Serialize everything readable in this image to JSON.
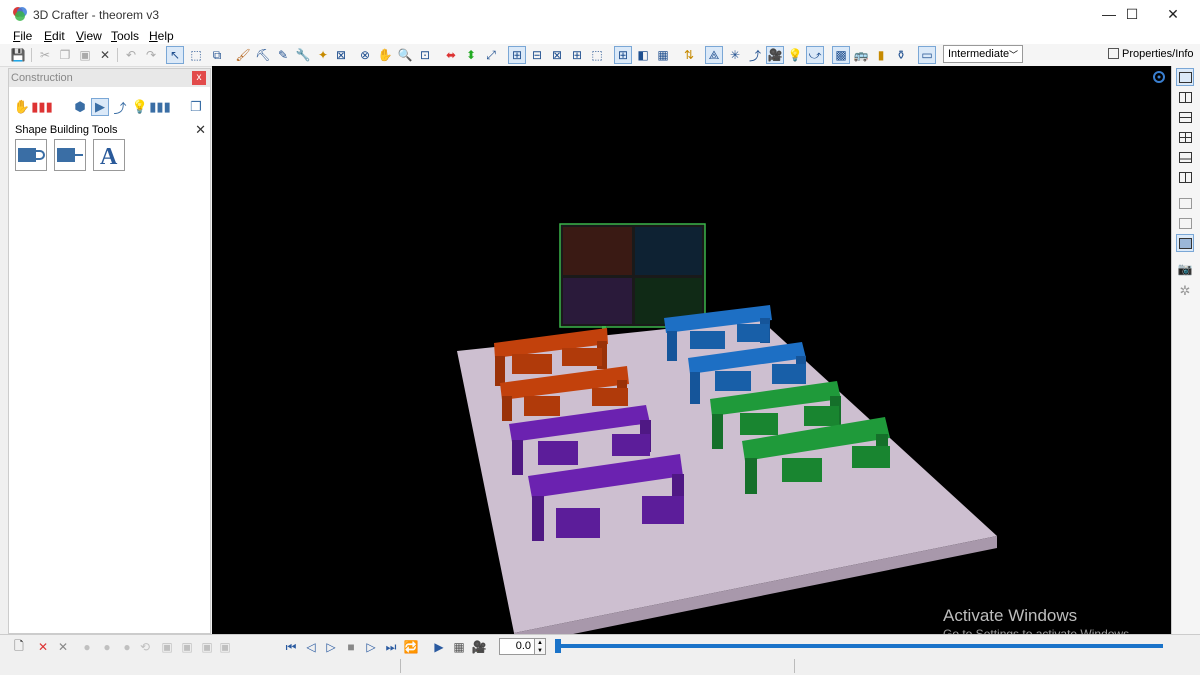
{
  "window": {
    "title": "3D Crafter - theorem v3",
    "minimize": "—",
    "maximize": "☐",
    "close": "✕"
  },
  "menu": [
    {
      "label": "File",
      "key": "F",
      "rest": "ile"
    },
    {
      "label": "Edit",
      "key": "E",
      "rest": "dit"
    },
    {
      "label": "View",
      "key": "V",
      "rest": "iew"
    },
    {
      "label": "Tools",
      "key": "T",
      "rest": "ools"
    },
    {
      "label": "Help",
      "key": "H",
      "rest": "elp"
    }
  ],
  "toolbar": {
    "level_select": "Intermediate",
    "properties_label": "Properties/Info"
  },
  "panel": {
    "title": "Construction",
    "close": "x",
    "section_title": "Shape Building Tools",
    "section_close": "✕"
  },
  "timeline": {
    "time_value": "0.0"
  },
  "watermark": {
    "line1": "Activate Windows",
    "line2": "Go to Settings to activate Windows."
  },
  "colors": {
    "accent": "#1a73c9",
    "floor": "#cdbfd0",
    "orange": "#c2410c",
    "blue": "#1d6fc4",
    "green": "#1f9a3a",
    "purple": "#6b22b0"
  }
}
